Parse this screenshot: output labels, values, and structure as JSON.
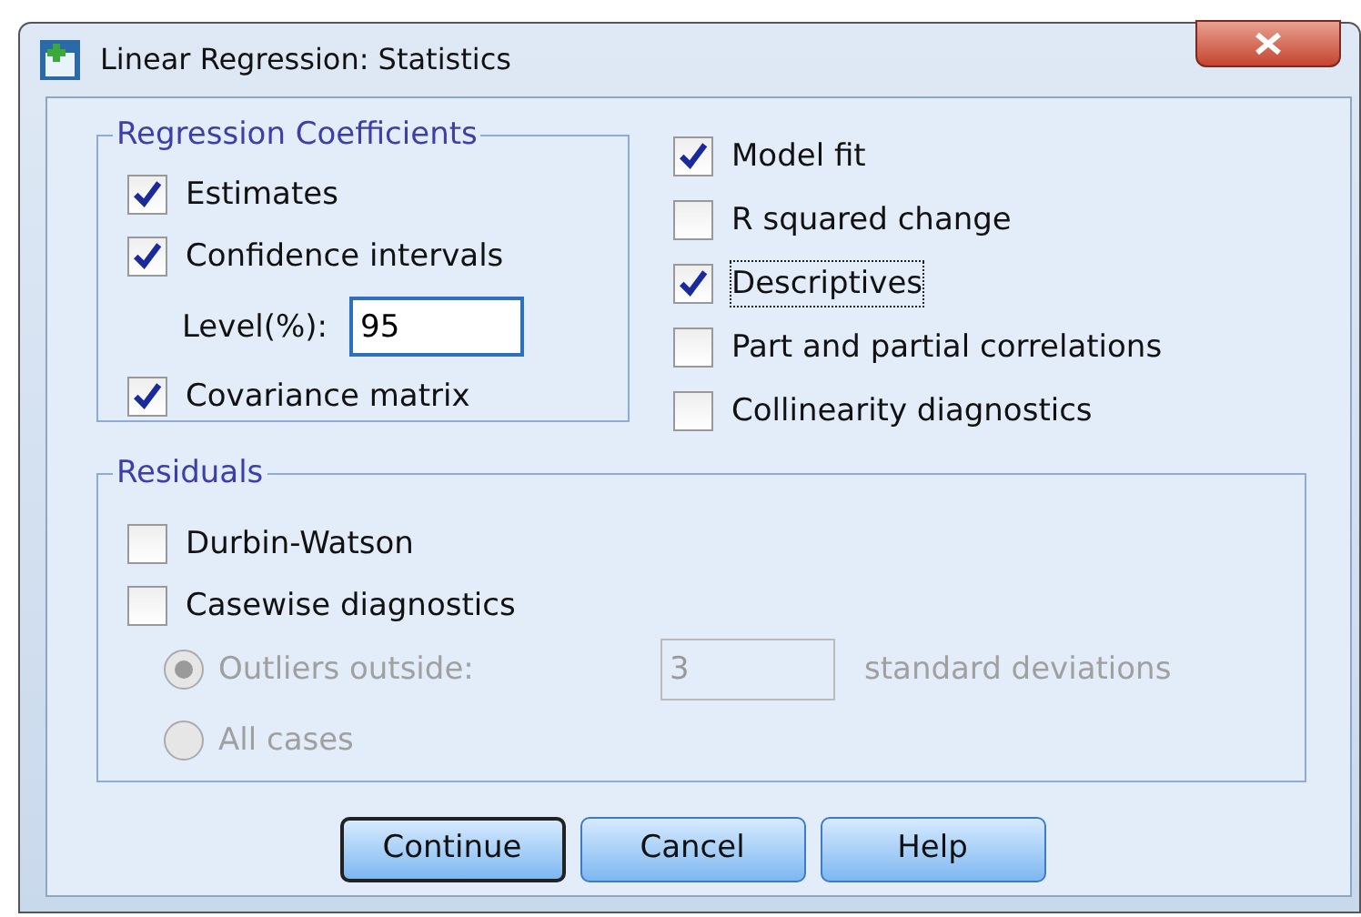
{
  "window": {
    "title": "Linear Regression: Statistics"
  },
  "coefficients": {
    "title": "Regression Coefficients",
    "items": [
      {
        "kind": "checkbox",
        "label": "Estimates",
        "checked": true
      },
      {
        "kind": "checkbox",
        "label": "Confidence intervals",
        "checked": true
      },
      {
        "kind": "field",
        "label": "Level(%):",
        "value": "95"
      },
      {
        "kind": "checkbox",
        "label": "Covariance matrix",
        "checked": true
      }
    ]
  },
  "options": [
    {
      "label": "Model fit",
      "checked": true,
      "focused": false
    },
    {
      "label": "R squared change",
      "checked": false,
      "focused": false
    },
    {
      "label": "Descriptives",
      "checked": true,
      "focused": true
    },
    {
      "label": "Part and partial correlations",
      "checked": false,
      "focused": false
    },
    {
      "label": "Collinearity diagnostics",
      "checked": false,
      "focused": false
    }
  ],
  "residuals": {
    "title": "Residuals",
    "items": [
      {
        "kind": "checkbox",
        "label": "Durbin-Watson",
        "checked": false
      },
      {
        "kind": "checkbox",
        "label": "Casewise diagnostics",
        "checked": false
      },
      {
        "kind": "radio",
        "label": "Outliers outside:",
        "selected": true,
        "disabled": true,
        "value": "3",
        "suffix": "standard deviations"
      },
      {
        "kind": "radio",
        "label": "All cases",
        "selected": false,
        "disabled": true
      }
    ]
  },
  "buttons": [
    {
      "label": "Continue",
      "default": true
    },
    {
      "label": "Cancel",
      "default": false
    },
    {
      "label": "Help",
      "default": false
    }
  ]
}
